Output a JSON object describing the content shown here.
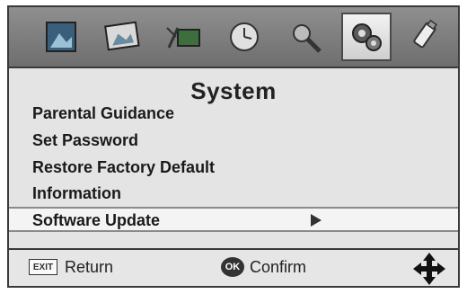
{
  "menu": {
    "title": "System",
    "items": [
      {
        "label": "Parental Guidance"
      },
      {
        "label": "Set Password"
      },
      {
        "label": "Restore Factory Default"
      },
      {
        "label": "Information"
      }
    ],
    "selected": {
      "label": "Software Update"
    }
  },
  "icons": [
    "picture-icon",
    "image-icon",
    "channel-icon",
    "clock-icon",
    "tools-icon",
    "system-gears-icon",
    "usb-icon"
  ],
  "footer": {
    "exit_key": "EXIT",
    "return_label": "Return",
    "ok_key": "OK",
    "confirm_label": "Confirm"
  }
}
